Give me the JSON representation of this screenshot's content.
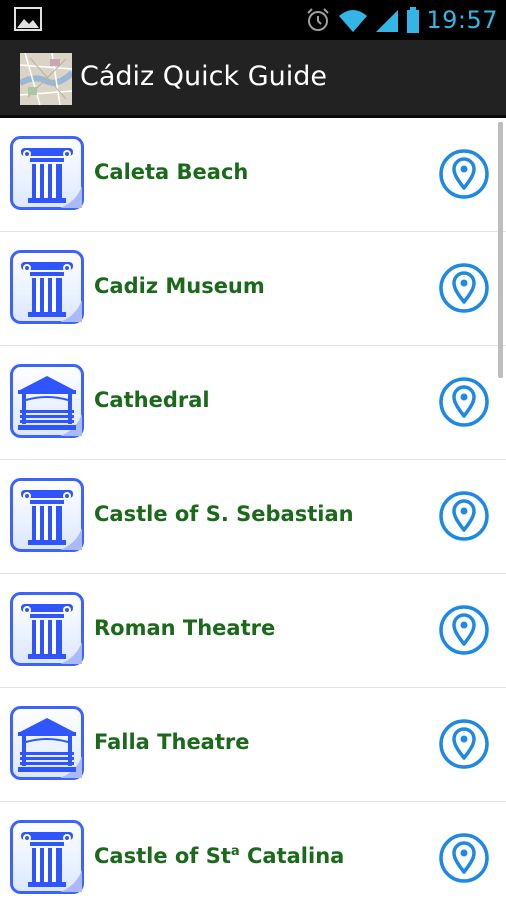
{
  "status_bar": {
    "time": "19:57",
    "icons": [
      "image-notification-icon",
      "alarm-icon",
      "wifi-icon",
      "signal-icon",
      "battery-icon"
    ]
  },
  "action_bar": {
    "title": "Cádiz Quick Guide",
    "icon": "map-thumbnail-icon"
  },
  "colors": {
    "label": "#1b6a1b",
    "accent": "#1e88e5",
    "status_time": "#33b5e5",
    "action_bar": "#222222"
  },
  "places": [
    {
      "label": "Caleta Beach",
      "icon": "column-icon"
    },
    {
      "label": "Cadiz Museum",
      "icon": "column-icon"
    },
    {
      "label": "Cathedral",
      "icon": "pavilion-icon"
    },
    {
      "label": "Castle of S. Sebastian",
      "icon": "column-icon"
    },
    {
      "label": "Roman Theatre",
      "icon": "column-icon"
    },
    {
      "label": "Falla Theatre",
      "icon": "pavilion-icon"
    },
    {
      "label_main": "Castle of St",
      "label_sup": "a",
      "label_rest": " Catalina",
      "icon": "column-icon"
    }
  ]
}
